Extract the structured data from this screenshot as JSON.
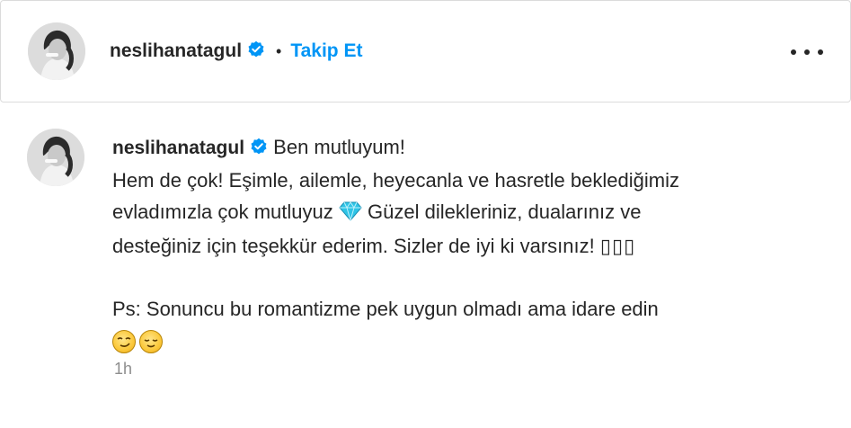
{
  "header": {
    "username": "neslihanatagul",
    "separator": "•",
    "follow_label": "Takip Et",
    "more_icon": "more-horizontal-icon"
  },
  "post": {
    "username": "neslihanatagul",
    "caption_lines": [
      "Ben mutluyum!",
      "Hem de çok! Eşimle, ailemle, heyecanla ve hasretle beklediğimiz",
      "evladımızla çok mutluyuz",
      "Güzel dilekleriniz, dualarınız ve",
      "desteğiniz için teşekkür ederim. Sizler de iyi ki varsınız!",
      "▯▯▯",
      "Ps: Sonuncu bu romantizme pek uygun olmadı ama idare edin"
    ],
    "timestamp": "1h",
    "emojis": [
      "gem-icon",
      "smirk-face-icon",
      "relieved-face-icon"
    ]
  },
  "colors": {
    "accent": "#0095f6",
    "verified": "#0095f6",
    "text": "#262626",
    "muted": "#8e8e8e",
    "border": "#dbdbdb"
  }
}
